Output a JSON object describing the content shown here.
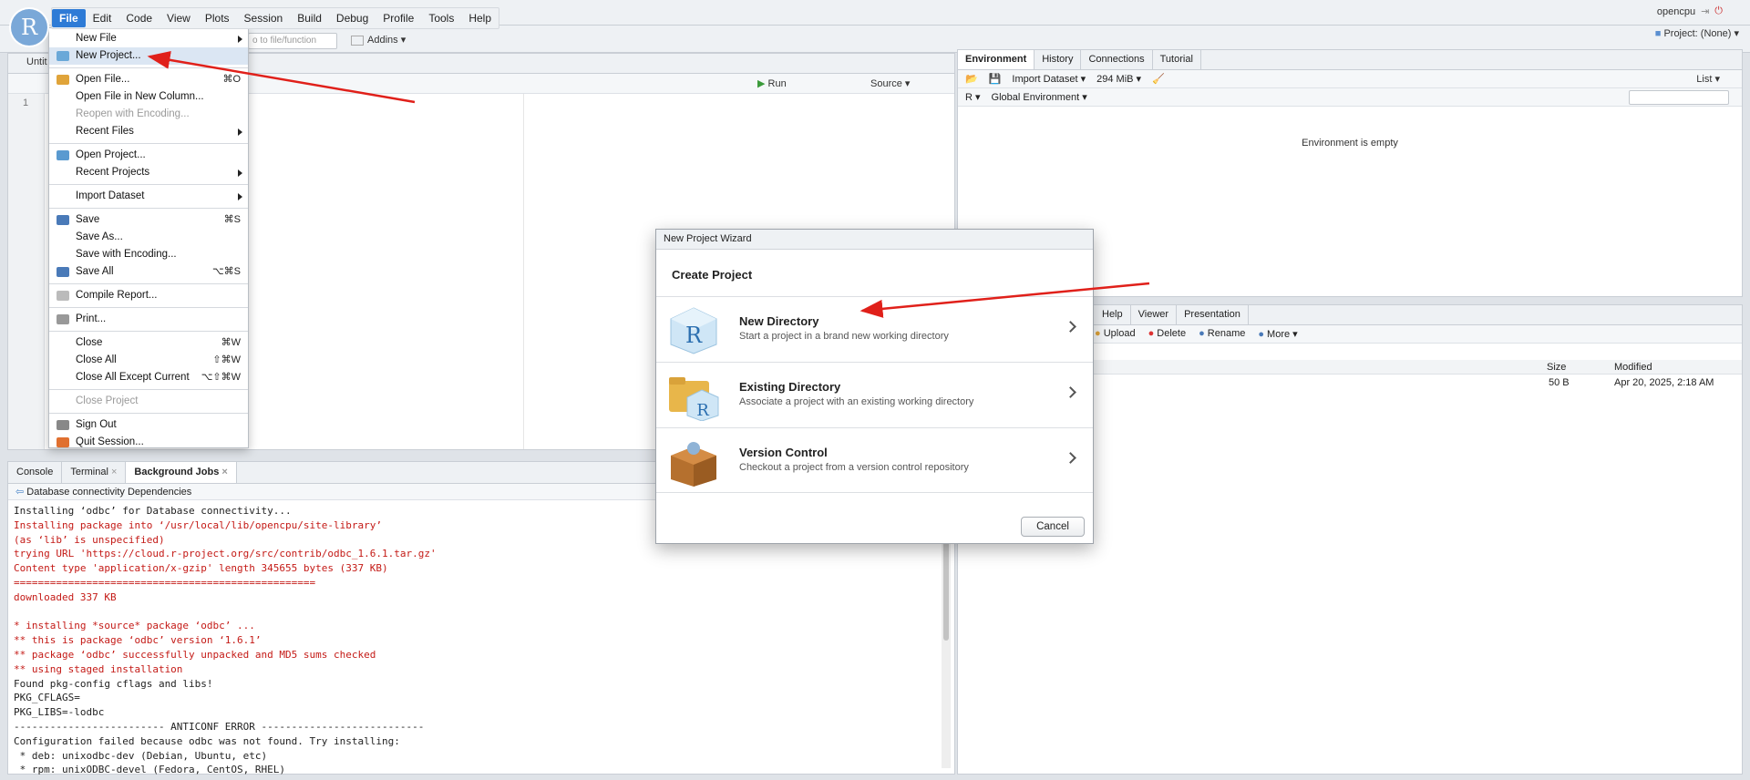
{
  "menubar": {
    "items": [
      "File",
      "Edit",
      "Code",
      "View",
      "Plots",
      "Session",
      "Build",
      "Debug",
      "Profile",
      "Tools",
      "Help"
    ],
    "active": "File"
  },
  "logo": "R",
  "toolbar": {
    "goto_placeholder": "o to file/function",
    "addins": "Addins"
  },
  "user": {
    "name": "opencpu"
  },
  "project": {
    "label": "Project: (None)"
  },
  "source": {
    "tab": "Untit",
    "line1": "1",
    "run": "Run",
    "source_btn": "Source"
  },
  "file_menu": {
    "items": [
      {
        "label": "New File",
        "submenu": true
      },
      {
        "label": "New Project...",
        "highlight": true,
        "icon": "new-project-icon"
      },
      {
        "sep": true
      },
      {
        "label": "Open File...",
        "shortcut": "⌘O",
        "icon": "open-file-icon"
      },
      {
        "label": "Open File in New Column..."
      },
      {
        "label": "Reopen with Encoding...",
        "disabled": true
      },
      {
        "label": "Recent Files",
        "submenu": true
      },
      {
        "sep": true
      },
      {
        "label": "Open Project...",
        "icon": "open-project-icon"
      },
      {
        "label": "Recent Projects",
        "submenu": true
      },
      {
        "sep": true
      },
      {
        "label": "Import Dataset",
        "submenu": true
      },
      {
        "sep": true
      },
      {
        "label": "Save",
        "shortcut": "⌘S",
        "icon": "save-icon"
      },
      {
        "label": "Save As..."
      },
      {
        "label": "Save with Encoding..."
      },
      {
        "label": "Save All",
        "shortcut": "⌥⌘S",
        "icon": "save-all-icon"
      },
      {
        "sep": true
      },
      {
        "label": "Compile Report...",
        "icon": "compile-report-icon"
      },
      {
        "sep": true
      },
      {
        "label": "Print...",
        "icon": "print-icon"
      },
      {
        "sep": true
      },
      {
        "label": "Close",
        "shortcut": "⌘W"
      },
      {
        "label": "Close All",
        "shortcut": "⇧⌘W"
      },
      {
        "label": "Close All Except Current",
        "shortcut": "⌥⇧⌘W"
      },
      {
        "sep": true
      },
      {
        "label": "Close Project",
        "disabled": true
      },
      {
        "sep": true
      },
      {
        "label": "Sign Out",
        "icon": "sign-out-icon"
      },
      {
        "label": "Quit Session...",
        "icon": "quit-icon"
      }
    ]
  },
  "console": {
    "tabs": [
      "Console",
      "Terminal",
      "Background Jobs"
    ],
    "selected": "Background Jobs",
    "job_title": "Database connectivity Dependencies",
    "lines": [
      {
        "t": "Installing ‘odbc’ for Database connectivity...",
        "c": "blk"
      },
      {
        "t": "Installing package into ‘/usr/local/lib/opencpu/site-library’",
        "c": "red"
      },
      {
        "t": "(as ‘lib’ is unspecified)",
        "c": "red"
      },
      {
        "t": "trying URL 'https://cloud.r-project.org/src/contrib/odbc_1.6.1.tar.gz'",
        "c": "red"
      },
      {
        "t": "Content type 'application/x-gzip' length 345655 bytes (337 KB)",
        "c": "red"
      },
      {
        "t": "==================================================",
        "c": "red"
      },
      {
        "t": "downloaded 337 KB",
        "c": "red"
      },
      {
        "t": "",
        "c": "blk"
      },
      {
        "t": "* installing *source* package ‘odbc’ ...",
        "c": "red"
      },
      {
        "t": "** this is package ‘odbc’ version ‘1.6.1’",
        "c": "red"
      },
      {
        "t": "** package ‘odbc’ successfully unpacked and MD5 sums checked",
        "c": "red"
      },
      {
        "t": "** using staged installation",
        "c": "red"
      },
      {
        "t": "Found pkg-config cflags and libs!",
        "c": "blk"
      },
      {
        "t": "PKG_CFLAGS=",
        "c": "blk"
      },
      {
        "t": "PKG_LIBS=-lodbc",
        "c": "blk"
      },
      {
        "t": "------------------------- ANTICONF ERROR ---------------------------",
        "c": "blk"
      },
      {
        "t": "Configuration failed because odbc was not found. Try installing:",
        "c": "blk"
      },
      {
        "t": " * deb: unixodbc-dev (Debian, Ubuntu, etc)",
        "c": "blk"
      },
      {
        "t": " * rpm: unixODBC-devel (Fedora, CentOS, RHEL)",
        "c": "blk"
      }
    ]
  },
  "env": {
    "tabs": [
      "Environment",
      "History",
      "Connections",
      "Tutorial"
    ],
    "selected": "Environment",
    "import": "Import Dataset",
    "mem": "294 MiB",
    "list": "List",
    "lang": "R",
    "scope": "Global Environment",
    "empty": "Environment is empty"
  },
  "files": {
    "tabs": [
      "Help",
      "Viewer",
      "Presentation"
    ],
    "tools": [
      "Upload",
      "Delete",
      "Rename",
      "More"
    ],
    "col_size": "Size",
    "col_modified": "Modified",
    "row_size": "50 B",
    "row_modified": "Apr 20, 2025, 2:18 AM"
  },
  "dialog": {
    "title": "New Project Wizard",
    "heading": "Create Project",
    "options": [
      {
        "title": "New Directory",
        "sub": "Start a project in a brand new working directory"
      },
      {
        "title": "Existing Directory",
        "sub": "Associate a project with an existing working directory"
      },
      {
        "title": "Version Control",
        "sub": "Checkout a project from a version control repository"
      }
    ],
    "cancel": "Cancel"
  }
}
